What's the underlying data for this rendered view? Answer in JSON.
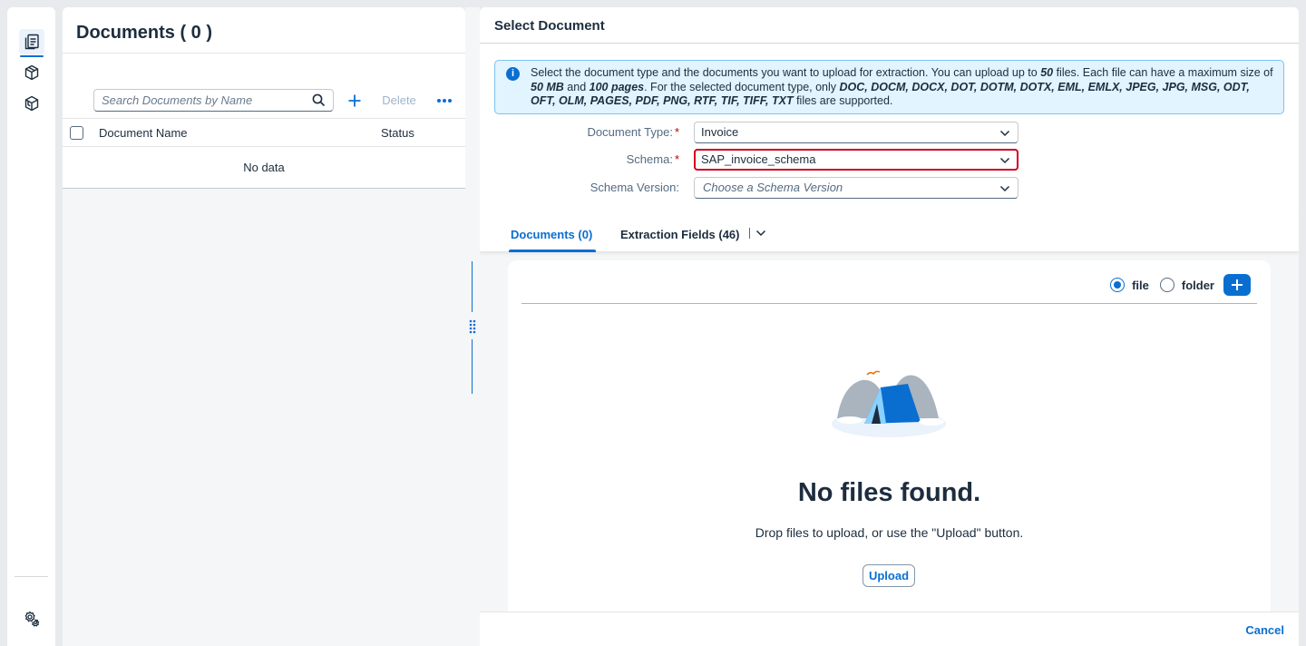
{
  "nav_rail": {
    "items": [
      {
        "icon": "documents-icon",
        "active": true
      },
      {
        "icon": "cube-icon",
        "active": false
      },
      {
        "icon": "package-icon",
        "active": false
      }
    ],
    "bottom_icon": "settings-icon"
  },
  "documents_panel": {
    "title": "Documents ( 0 )",
    "search_placeholder": "Search Documents by Name",
    "delete_label": "Delete",
    "columns": {
      "name": "Document Name",
      "status": "Status"
    },
    "empty_text": "No data"
  },
  "dialog": {
    "title": "Select Document",
    "info": {
      "p1": "Select the document type and the documents you want to upload for extraction. You can upload up to ",
      "max_files": "50",
      "p2": " files. Each file can have a maximum size of ",
      "max_size": "50 MB",
      "p3": " and ",
      "max_pages": "100 pages",
      "p4": ". For the selected document type, only ",
      "formats": "DOC, DOCM, DOCX, DOT, DOTM, DOTX, EML, EMLX, JPEG, JPG, MSG, ODT, OFT, OLM, PAGES, PDF, PNG, RTF, TIF, TIFF, TXT",
      "p5": " files are supported."
    },
    "form": {
      "document_type_label": "Document Type:",
      "document_type_value": "Invoice",
      "schema_label": "Schema:",
      "schema_value": "SAP_invoice_schema",
      "schema_version_label": "Schema Version:",
      "schema_version_placeholder": "Choose a Schema Version",
      "required_mark": "*"
    },
    "tabs": [
      {
        "label": "Documents (0)",
        "selected": true
      },
      {
        "label": "Extraction Fields (46)",
        "selected": false
      }
    ],
    "upload": {
      "radio_file": "file",
      "radio_folder": "folder",
      "empty_title": "No files found.",
      "empty_subtitle": "Drop files to upload, or use the \"Upload\" button.",
      "upload_button": "Upload"
    },
    "cancel_label": "Cancel"
  },
  "colors": {
    "accent": "#0a6ed1",
    "highlight_border": "#d0021b",
    "info_bg": "#e1f4ff"
  }
}
